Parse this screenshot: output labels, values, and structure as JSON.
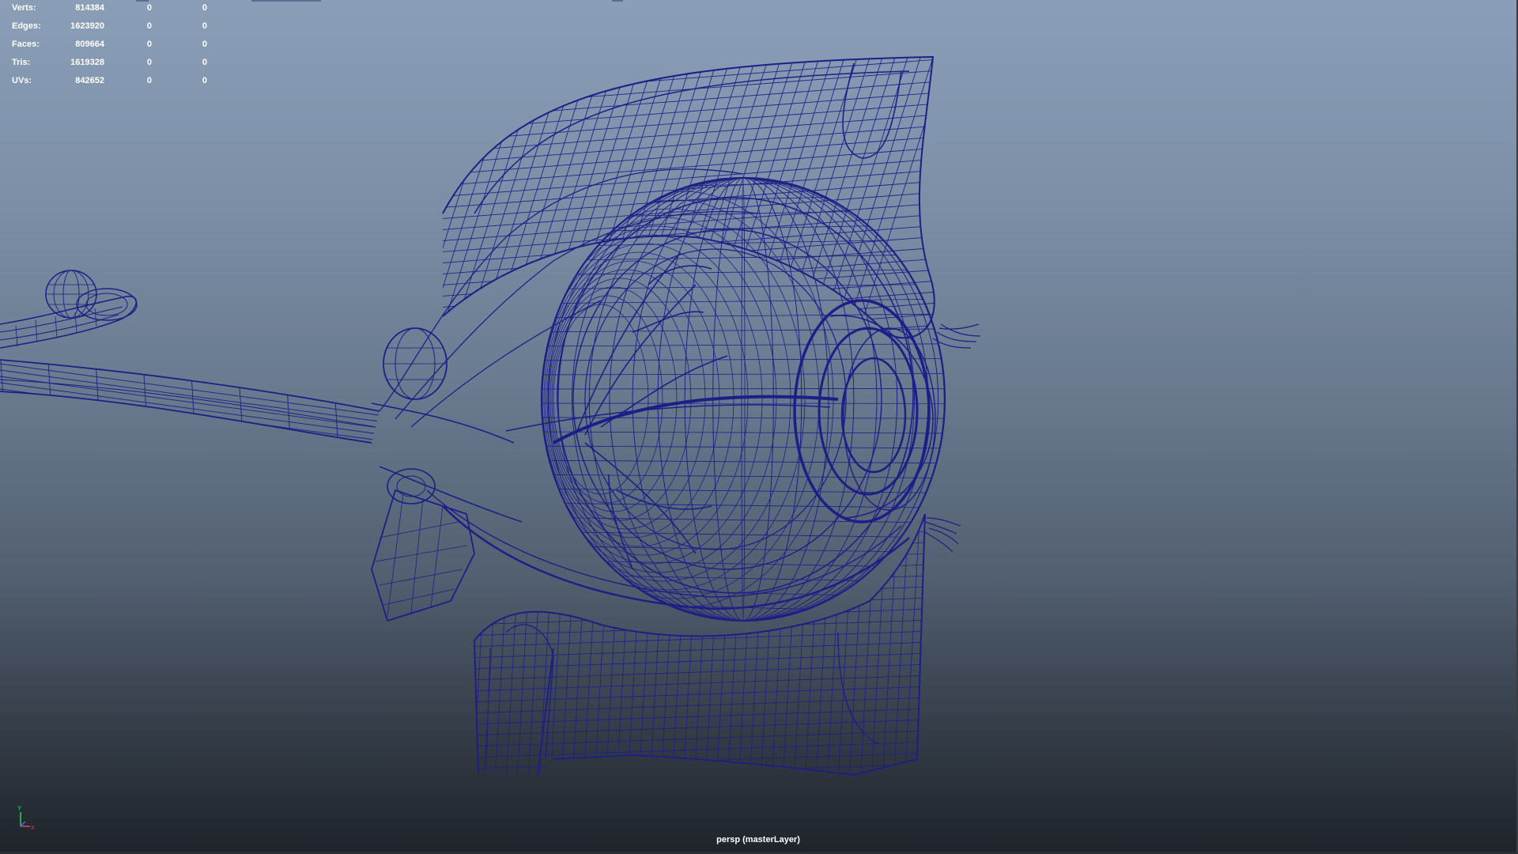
{
  "hud": {
    "rows": [
      {
        "label": "Verts:",
        "total": "814384",
        "selected": "0",
        "component": "0"
      },
      {
        "label": "Edges:",
        "total": "1623920",
        "selected": "0",
        "component": "0"
      },
      {
        "label": "Faces:",
        "total": "809664",
        "selected": "0",
        "component": "0"
      },
      {
        "label": "Tris:",
        "total": "1619328",
        "selected": "0",
        "component": "0"
      },
      {
        "label": "UVs:",
        "total": "842652",
        "selected": "0",
        "component": "0"
      }
    ]
  },
  "viewport": {
    "camera_label": "persp (masterLayer)",
    "display_mode": "wireframe",
    "wire_color": "#1f1e86",
    "background_top": "#8a9eb8",
    "background_bottom": "#1f242b"
  },
  "axis_gizmo": {
    "y": "Y",
    "x": "X",
    "y_color": "#2fd04a",
    "x_color": "#e04545",
    "z_color": "#4a6aff"
  }
}
